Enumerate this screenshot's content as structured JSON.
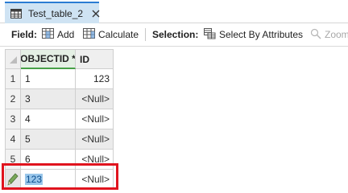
{
  "tab": {
    "title": "Test_table_2",
    "icon": "table-icon",
    "close_icon": "close-icon"
  },
  "toolbar": {
    "field_label": "Field:",
    "add_label": "Add",
    "calculate_label": "Calculate",
    "selection_label": "Selection:",
    "select_by_attributes_label": "Select By Attributes",
    "zoom_label": "Zoom"
  },
  "table": {
    "columns": [
      "OBJECTID *",
      "ID"
    ],
    "rows": [
      {
        "num": "1",
        "objectid": "1",
        "id": "123"
      },
      {
        "num": "2",
        "objectid": "3",
        "id": "<Null>"
      },
      {
        "num": "3",
        "objectid": "4",
        "id": "<Null>"
      },
      {
        "num": "4",
        "objectid": "5",
        "id": "<Null>"
      },
      {
        "num": "5",
        "objectid": "6",
        "id": "<Null>"
      }
    ],
    "edit_row": {
      "objectid": "123",
      "id": "<Null>",
      "icon": "pencil-icon"
    }
  },
  "colors": {
    "accent": "#2b7cd3",
    "highlight": "#e0141e",
    "selection": "#99c6ea"
  }
}
